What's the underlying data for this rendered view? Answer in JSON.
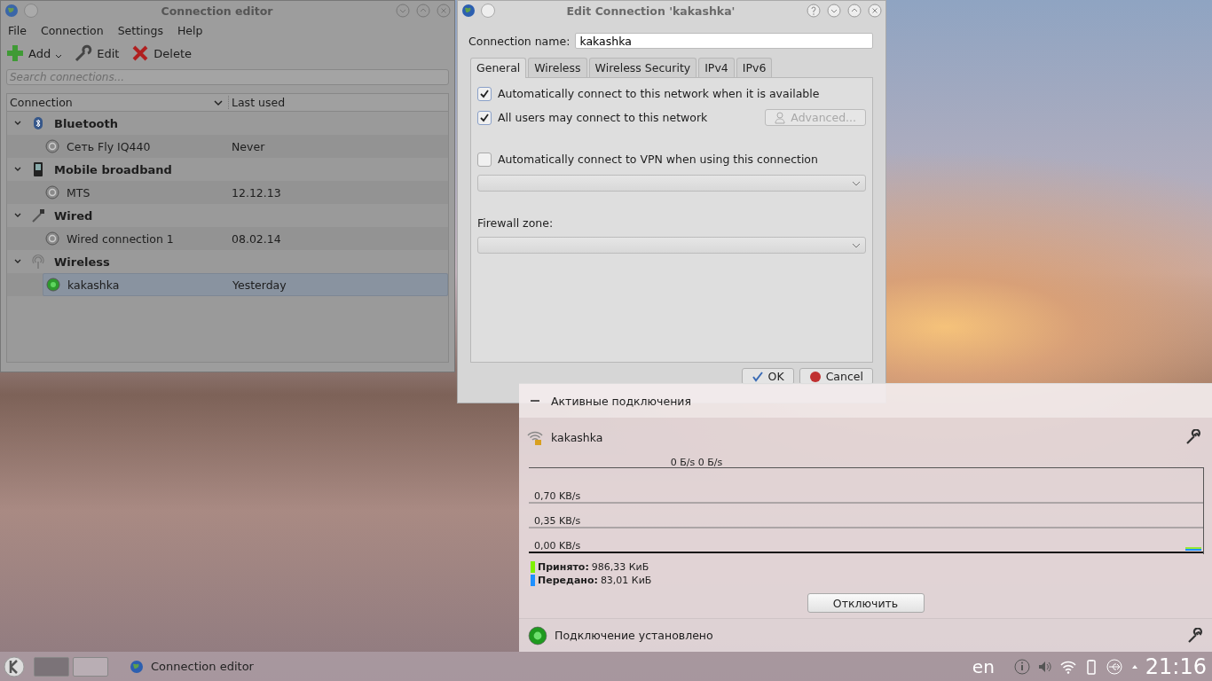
{
  "connection_editor": {
    "title": "Connection editor",
    "menu": [
      "File",
      "Connection",
      "Settings",
      "Help"
    ],
    "toolbar": [
      {
        "label": "Add",
        "kind": "add"
      },
      {
        "label": "Edit",
        "kind": "edit"
      },
      {
        "label": "Delete",
        "kind": "delete"
      }
    ],
    "search": {
      "placeholder": "Search connections..."
    },
    "columns": [
      "Connection",
      "Last used"
    ],
    "groups": [
      {
        "name": "Bluetooth",
        "kind": "bluetooth",
        "expanded": true,
        "children": [
          {
            "name": "Сеть Fly IQ440",
            "last_used": "Never",
            "connected": false,
            "selected": false
          }
        ]
      },
      {
        "name": "Mobile broadband",
        "kind": "mobile",
        "expanded": true,
        "children": [
          {
            "name": "MTS",
            "last_used": "12.12.13",
            "connected": false,
            "selected": false
          }
        ]
      },
      {
        "name": "Wired",
        "kind": "wired",
        "expanded": true,
        "children": [
          {
            "name": "Wired connection 1",
            "last_used": "08.02.14",
            "connected": false,
            "selected": false
          }
        ]
      },
      {
        "name": "Wireless",
        "kind": "wireless",
        "expanded": true,
        "children": [
          {
            "name": "kakashka",
            "last_used": "Yesterday",
            "connected": true,
            "selected": true
          }
        ]
      }
    ]
  },
  "edit_dialog": {
    "title": "Edit Connection 'kakashka'",
    "name_label": "Connection name:",
    "name_value": "kakashka",
    "tabs": [
      {
        "label": "General",
        "selected": true
      },
      {
        "label": "Wireless",
        "selected": false
      },
      {
        "label": "Wireless Security",
        "selected": false
      },
      {
        "label": "IPv4",
        "selected": false
      },
      {
        "label": "IPv6",
        "selected": false
      }
    ],
    "options": [
      {
        "label": "Automatically connect to this network when it is available",
        "checked": true
      },
      {
        "label": "All users may connect to this network",
        "checked": true,
        "button": {
          "label": "Advanced...",
          "disabled": true
        }
      },
      {
        "label": "Automatically connect to VPN when using this connection",
        "checked": false
      }
    ],
    "firewall_label": "Firewall zone:",
    "buttons": [
      {
        "label": "OK",
        "kind": "ok"
      },
      {
        "label": "Cancel",
        "kind": "cancel"
      }
    ]
  },
  "network_popup": {
    "header": "Активные подключения",
    "expanded": true,
    "connection": "kakashka",
    "current_rate": "0 Б/s 0 Б/s",
    "scale_labels": [
      "0,70 KB/s",
      "0,35 KB/s",
      "0,00 KB/s"
    ],
    "stats": [
      {
        "label": "Принято:",
        "value": "986,33 КиБ",
        "color": "#7ff000"
      },
      {
        "label": "Передано:",
        "value": "83,01 КиБ",
        "color": "#1e90ff"
      }
    ],
    "disconnect_button": "Отключить",
    "status": {
      "text": "Подключение установлено",
      "connected": true
    }
  },
  "taskbar": {
    "pager": [
      {
        "selected": true
      },
      {
        "selected": false
      }
    ],
    "task": "Connection editor",
    "keyboard_layout": "en",
    "clock": "21:16"
  }
}
